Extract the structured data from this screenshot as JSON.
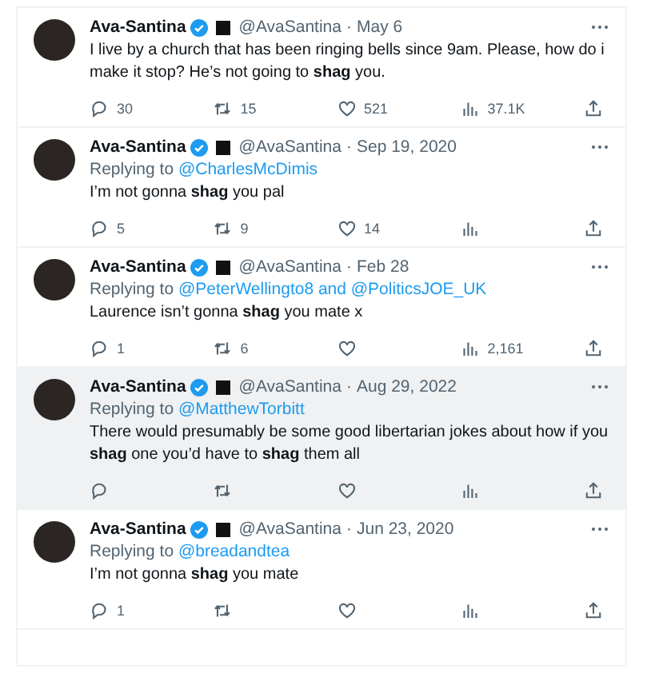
{
  "tweets": [
    {
      "name": "Ava-Santina",
      "handle": "@AvaSantina",
      "separator": "·",
      "date": "May 6",
      "highlighted": false,
      "text": "I live by a church that has been ringing bells since 9am. Please, how do i make it stop? He’s not going to **shag** you.",
      "metrics": [
        {
          "kind": "reply",
          "count": "30"
        },
        {
          "kind": "retweet",
          "count": "15"
        },
        {
          "kind": "like",
          "count": "521"
        },
        {
          "kind": "views",
          "count": "37.1K"
        },
        {
          "kind": "share"
        }
      ]
    },
    {
      "name": "Ava-Santina",
      "handle": "@AvaSantina",
      "separator": "·",
      "date": "Sep 19, 2020",
      "highlighted": false,
      "replying": {
        "prefix": "Replying to",
        "to": "@CharlesMcDimis"
      },
      "text": "I’m not gonna **shag** you pal",
      "metrics": [
        {
          "kind": "reply",
          "count": "5"
        },
        {
          "kind": "retweet",
          "count": "9"
        },
        {
          "kind": "like",
          "count": "14"
        },
        {
          "kind": "views"
        },
        {
          "kind": "share"
        }
      ]
    },
    {
      "name": "Ava-Santina",
      "handle": "@AvaSantina",
      "separator": "·",
      "date": "Feb 28",
      "highlighted": false,
      "replying": {
        "prefix": "Replying to",
        "to": "@PeterWellingto8 and @PoliticsJOE_UK"
      },
      "text": "Laurence isn’t gonna **shag** you mate x",
      "metrics": [
        {
          "kind": "reply",
          "count": "1"
        },
        {
          "kind": "retweet",
          "count": "6"
        },
        {
          "kind": "like"
        },
        {
          "kind": "views",
          "count": "2,161"
        },
        {
          "kind": "share"
        }
      ]
    },
    {
      "name": "Ava-Santina",
      "handle": "@AvaSantina",
      "separator": "·",
      "date": "Aug 29, 2022",
      "highlighted": true,
      "replying": {
        "prefix": "Replying to",
        "to": "@MatthewTorbitt"
      },
      "text": "There would presumably be some good libertarian jokes about how if you **shag** one you’d have to **shag** them all",
      "metrics": [
        {
          "kind": "reply"
        },
        {
          "kind": "retweet"
        },
        {
          "kind": "like"
        },
        {
          "kind": "views"
        },
        {
          "kind": "share"
        }
      ]
    },
    {
      "name": "Ava-Santina",
      "handle": "@AvaSantina",
      "separator": "·",
      "date": "Jun 23, 2020",
      "highlighted": false,
      "replying": {
        "prefix": "Replying to",
        "to": "@breadandtea"
      },
      "text": "I’m not gonna **shag** you mate",
      "metrics": [
        {
          "kind": "reply",
          "count": "1"
        },
        {
          "kind": "retweet"
        },
        {
          "kind": "like"
        },
        {
          "kind": "views"
        },
        {
          "kind": "share"
        }
      ]
    }
  ]
}
